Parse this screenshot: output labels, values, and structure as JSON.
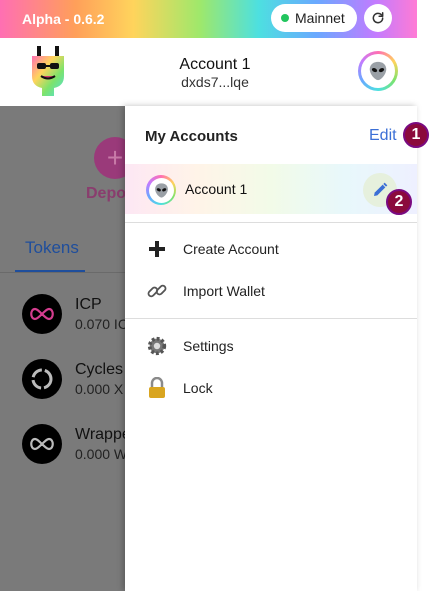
{
  "topbar": {
    "version": "Alpha - 0.6.2",
    "network": "Mainnet"
  },
  "header": {
    "account_name": "Account 1",
    "account_address": "dxds7...lqe"
  },
  "background": {
    "deposit_label": "Depo",
    "tab_label": "Tokens",
    "tokens": [
      {
        "name": "ICP",
        "amount": "0.070 IC"
      },
      {
        "name": "Cycles",
        "amount": "0.000 X"
      },
      {
        "name": "Wrappe",
        "amount": "0.000 W"
      }
    ]
  },
  "drawer": {
    "title": "My Accounts",
    "edit_label": "Edit",
    "accounts": [
      {
        "name": "Account 1"
      }
    ],
    "menu": {
      "create_account": "Create Account",
      "import_wallet": "Import Wallet",
      "settings": "Settings",
      "lock": "Lock"
    }
  },
  "annotations": {
    "badge1": "1",
    "badge2": "2"
  },
  "colors": {
    "accent": "#3b6fd6",
    "badge": "#8b0a3c",
    "network_dot": "#22c55e"
  }
}
